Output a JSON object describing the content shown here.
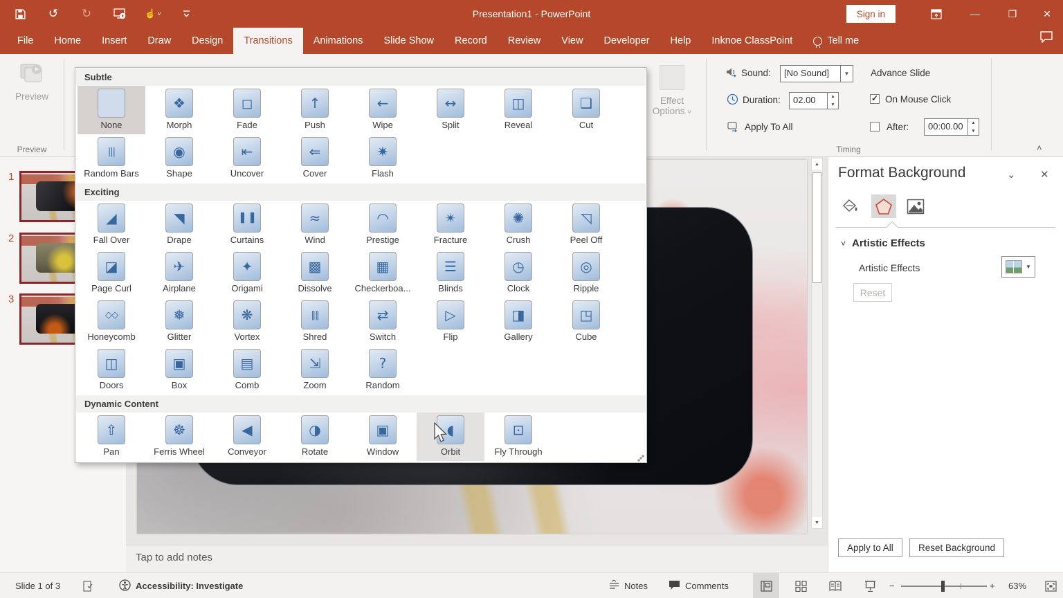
{
  "colors": {
    "brand_red": "#b5482a",
    "gallery_icon_blue": "#38679e",
    "thumb_border_maroon": "#8b262b",
    "selected_gray": "#d5d2d0"
  },
  "titlebar": {
    "title": "Presentation1 - PowerPoint",
    "sign_in_label": "Sign in"
  },
  "tabs": [
    {
      "label": "File"
    },
    {
      "label": "Home"
    },
    {
      "label": "Insert"
    },
    {
      "label": "Draw"
    },
    {
      "label": "Design"
    },
    {
      "label": "Transitions",
      "active": true
    },
    {
      "label": "Animations"
    },
    {
      "label": "Slide Show"
    },
    {
      "label": "Record"
    },
    {
      "label": "Review"
    },
    {
      "label": "View"
    },
    {
      "label": "Developer"
    },
    {
      "label": "Help"
    },
    {
      "label": "Inknoe ClassPoint"
    },
    {
      "label": "Tell me",
      "icon": "lightbulb"
    }
  ],
  "ribbon": {
    "preview_button_label": "Preview",
    "preview_group_label": "Preview",
    "effect_options_line1": "Effect",
    "effect_options_line2": "Options",
    "sound_label": "Sound:",
    "sound_value": "[No Sound]",
    "duration_label": "Duration:",
    "duration_value": "02.00",
    "apply_to_all_label": "Apply To All",
    "advance_slide_label": "Advance Slide",
    "on_mouse_click_label": "On Mouse Click",
    "after_label": "After:",
    "after_value": "00:00.00",
    "timing_group_label": "Timing"
  },
  "gallery": {
    "sections": [
      {
        "title": "Subtle",
        "items": [
          {
            "label": "None",
            "glyph": "",
            "state": "selected"
          },
          {
            "label": "Morph",
            "glyph": "❖"
          },
          {
            "label": "Fade",
            "glyph": "◻"
          },
          {
            "label": "Push",
            "glyph": "↑"
          },
          {
            "label": "Wipe",
            "glyph": "←"
          },
          {
            "label": "Split",
            "glyph": "↔"
          },
          {
            "label": "Reveal",
            "glyph": "◫"
          },
          {
            "label": "Cut",
            "glyph": "❏"
          },
          {
            "label": "Random Bars",
            "glyph": "|||"
          },
          {
            "label": "Shape",
            "glyph": "◉"
          },
          {
            "label": "Uncover",
            "glyph": "⇤"
          },
          {
            "label": "Cover",
            "glyph": "⇐"
          },
          {
            "label": "Flash",
            "glyph": "✷"
          }
        ]
      },
      {
        "title": "Exciting",
        "items": [
          {
            "label": "Fall Over",
            "glyph": "◢"
          },
          {
            "label": "Drape",
            "glyph": "◥"
          },
          {
            "label": "Curtains",
            "glyph": "▌▐"
          },
          {
            "label": "Wind",
            "glyph": "≈"
          },
          {
            "label": "Prestige",
            "glyph": "◠"
          },
          {
            "label": "Fracture",
            "glyph": "✴"
          },
          {
            "label": "Crush",
            "glyph": "✺"
          },
          {
            "label": "Peel Off",
            "glyph": "◹"
          },
          {
            "label": "Page Curl",
            "glyph": "◪"
          },
          {
            "label": "Airplane",
            "glyph": "✈"
          },
          {
            "label": "Origami",
            "glyph": "✦"
          },
          {
            "label": "Dissolve",
            "glyph": "▩"
          },
          {
            "label": "Checkerboa...",
            "glyph": "▦"
          },
          {
            "label": "Blinds",
            "glyph": "☰"
          },
          {
            "label": "Clock",
            "glyph": "◷"
          },
          {
            "label": "Ripple",
            "glyph": "◎"
          },
          {
            "label": "Honeycomb",
            "glyph": "◇◇"
          },
          {
            "label": "Glitter",
            "glyph": "❅"
          },
          {
            "label": "Vortex",
            "glyph": "❋"
          },
          {
            "label": "Shred",
            "glyph": "‖‖"
          },
          {
            "label": "Switch",
            "glyph": "⇄"
          },
          {
            "label": "Flip",
            "glyph": "▷"
          },
          {
            "label": "Gallery",
            "glyph": "◨"
          },
          {
            "label": "Cube",
            "glyph": "◳"
          },
          {
            "label": "Doors",
            "glyph": "◫"
          },
          {
            "label": "Box",
            "glyph": "▣"
          },
          {
            "label": "Comb",
            "glyph": "▤"
          },
          {
            "label": "Zoom",
            "glyph": "⇲"
          },
          {
            "label": "Random",
            "glyph": "?"
          }
        ]
      },
      {
        "title": "Dynamic Content",
        "items": [
          {
            "label": "Pan",
            "glyph": "⇧"
          },
          {
            "label": "Ferris Wheel",
            "glyph": "☸"
          },
          {
            "label": "Conveyor",
            "glyph": "◀"
          },
          {
            "label": "Rotate",
            "glyph": "◑"
          },
          {
            "label": "Window",
            "glyph": "▣"
          },
          {
            "label": "Orbit",
            "glyph": "◖",
            "state": "hover"
          },
          {
            "label": "Fly Through",
            "glyph": "⊡"
          }
        ]
      }
    ]
  },
  "slide_panel": {
    "slides": [
      {
        "num": "1"
      },
      {
        "num": "2"
      },
      {
        "num": "3"
      }
    ]
  },
  "format_panel": {
    "title": "Format Background",
    "section_title": "Artistic Effects",
    "row_label": "Artistic Effects",
    "reset_label": "Reset",
    "apply_all_label": "Apply to All",
    "reset_background_label": "Reset Background"
  },
  "notes": {
    "placeholder": "Tap to add notes"
  },
  "statusbar": {
    "slide_info": "Slide 1 of 3",
    "accessibility": "Accessibility: Investigate",
    "notes_label": "Notes",
    "comments_label": "Comments",
    "zoom_level": "63%"
  }
}
